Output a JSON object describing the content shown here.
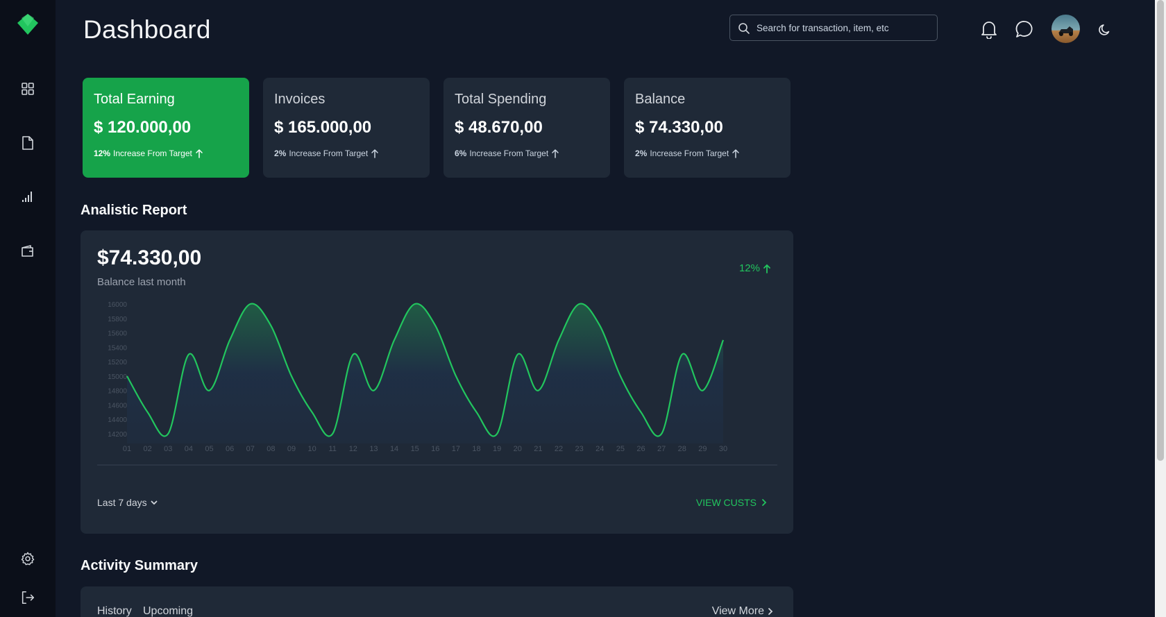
{
  "header": {
    "title": "Dashboard",
    "search_placeholder": "Search for transaction, item, etc"
  },
  "stats": [
    {
      "label": "Total Earning",
      "amount": "$ 120.000,00",
      "pct": "12%",
      "trend_text": "Increase From Target",
      "highlight": true
    },
    {
      "label": "Invoices",
      "amount": "$ 165.000,00",
      "pct": "2%",
      "trend_text": "Increase From Target",
      "highlight": false
    },
    {
      "label": "Total Spending",
      "amount": "$ 48.670,00",
      "pct": "6%",
      "trend_text": "Increase From Target",
      "highlight": false
    },
    {
      "label": "Balance",
      "amount": "$ 74.330,00",
      "pct": "2%",
      "trend_text": "Increase From Target",
      "highlight": false
    }
  ],
  "report": {
    "section_title": "Analistic Report",
    "amount": "$74.330,00",
    "subtitle": "Balance last month",
    "pct": "12%",
    "range_label": "Last 7 days",
    "view_label": "VIEW CUSTS"
  },
  "activity": {
    "section_title": "Activity Summary",
    "tabs": [
      "History",
      "Upcoming"
    ],
    "more_label": "View More"
  },
  "colors": {
    "accent": "#22c55e",
    "card_highlight": "#16a34a",
    "card": "#1f2937",
    "background": "#111827",
    "sidebar": "#0b0f19"
  },
  "icons": {
    "sidebar": [
      "grid-icon",
      "document-icon",
      "bar-chart-icon",
      "wallet-icon",
      "settings-icon",
      "logout-icon"
    ],
    "header": [
      "search-icon",
      "bell-icon",
      "chat-icon",
      "moon-icon"
    ]
  },
  "chart_data": {
    "type": "area",
    "x": [
      "01",
      "02",
      "03",
      "04",
      "05",
      "06",
      "07",
      "08",
      "09",
      "10",
      "11",
      "12",
      "13",
      "14",
      "15",
      "16",
      "17",
      "18",
      "19",
      "20",
      "21",
      "22",
      "23",
      "24",
      "25",
      "26",
      "27",
      "28",
      "29",
      "30"
    ],
    "values": [
      15000,
      14500,
      14200,
      15300,
      14800,
      15500,
      16000,
      15700,
      15000,
      14500,
      14200,
      15300,
      14800,
      15500,
      16000,
      15700,
      15000,
      14500,
      14200,
      15300,
      14800,
      15500,
      16000,
      15700,
      15000,
      14500,
      14200,
      15300,
      14800,
      15500
    ],
    "yticks": [
      16000,
      15800,
      15600,
      15400,
      15200,
      15000,
      14800,
      14600,
      14400,
      14200
    ],
    "ylim": [
      14200,
      16000
    ],
    "grid": false,
    "line_color": "#22c55e"
  }
}
